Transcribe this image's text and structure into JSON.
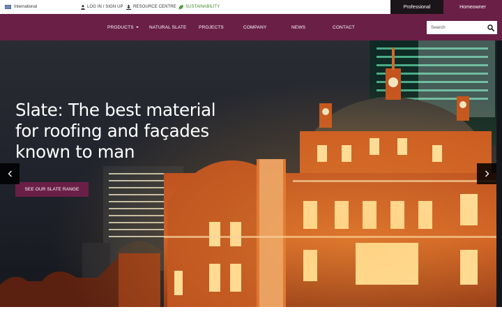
{
  "topbar": {
    "region_label": "International",
    "links": {
      "login": "LOG IN / SIGN UP",
      "resources": "RESOURCE CENTRE",
      "sustainability": "SUSTAINABILITY"
    },
    "audience_tabs": {
      "professional": "Professional",
      "homeowner": "Homeowner"
    }
  },
  "nav": {
    "items": [
      "PRODUCTS",
      "NATURAL SLATE",
      "PROJECTS",
      "COMPANY",
      "NEWS",
      "CONTACT"
    ],
    "search_placeholder": "Search"
  },
  "hero": {
    "title": "Slate: The best material for roofing and façades known to man",
    "cta_label": "SEE OUR SLATE RANGE"
  },
  "icons": {
    "region": "flag-icon",
    "login": "user-icon",
    "resources": "download-icon",
    "sustainability": "leaf-icon",
    "products_dropdown": "caret-down-icon",
    "search": "search-icon",
    "prev": "chevron-left-icon",
    "next": "chevron-right-icon"
  },
  "colors": {
    "brand": "#6a1f47",
    "professional_tab": "#1b1419",
    "sustainability": "#3d8a22"
  }
}
